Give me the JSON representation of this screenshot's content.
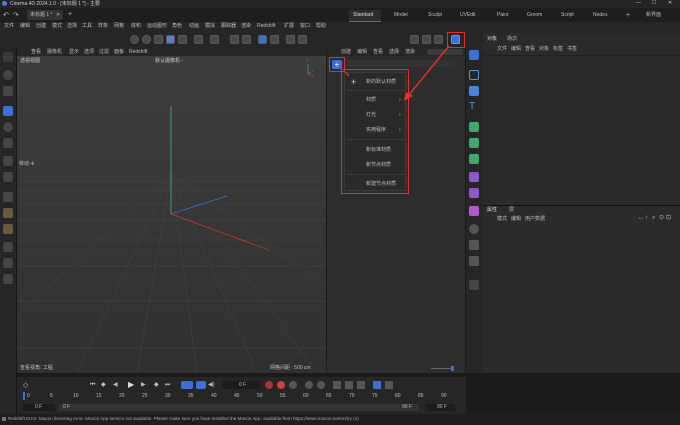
{
  "window": {
    "title": "Cinema 4D 2024.1.0 - [未标题 1 *] - 主要"
  },
  "doc_tab": {
    "label": "未标题 1 *"
  },
  "layouts": [
    "Standard",
    "Model",
    "Sculpt",
    "UVEdit",
    "Paint",
    "Groom",
    "Script",
    "Nodes"
  ],
  "new_ui": {
    "label": "新界面"
  },
  "menus": [
    "文件",
    "编辑",
    "创建",
    "模式",
    "选择",
    "工具",
    "样条",
    "网格",
    "体积",
    "运动图形",
    "角色",
    "动画",
    "模拟",
    "跟踪器",
    "渲染",
    "Redshift",
    "扩展",
    "窗口",
    "帮助"
  ],
  "viewport": {
    "menus": [
      "查看",
      "摄像机",
      "显示",
      "选项",
      "过滤",
      "面板",
      "Redshift"
    ],
    "name": "透视视图",
    "camera": "默认摄像机 ◦",
    "move_label": "移动 ✣",
    "display_mode": "查看视角: 工程",
    "grid_spacing": "网格间距 : 500 cm",
    "axis": {
      "y": "Y",
      "x": "X",
      "z": "Z"
    }
  },
  "mid_panel": {
    "menus": [
      "创建",
      "编辑",
      "查看",
      "选择",
      "渲染"
    ],
    "dropdown": [
      {
        "label": "新的默认材质",
        "icon": "plus-icon"
      },
      {
        "label": "材质",
        "submenu": true
      },
      {
        "label": "灯光",
        "submenu": true
      },
      {
        "label": "实用程序",
        "submenu": true
      },
      {
        "label": "新标准材质"
      },
      {
        "label": "新节点材质"
      },
      {
        "label": "新建节点材质"
      }
    ]
  },
  "objects_panel": {
    "tabs": [
      "对象",
      "场次"
    ],
    "menus": [
      "文件",
      "编辑",
      "查看",
      "对象",
      "标签",
      "书签"
    ]
  },
  "attributes_panel": {
    "tabs": [
      "属性",
      "层"
    ],
    "menus": [
      "模式",
      "编辑",
      "用户数据"
    ]
  },
  "timeline": {
    "current_frame": "0 F",
    "ticks": [
      "0",
      "5",
      "10",
      "15",
      "20",
      "25",
      "30",
      "35",
      "40",
      "45",
      "50",
      "55",
      "60",
      "65",
      "70",
      "75",
      "80",
      "85",
      "90"
    ],
    "start": "0 F",
    "start2": "0 F",
    "end": "90 F",
    "end2": "90 F"
  },
  "status": {
    "text": "Redshift Error: Maxon licensing error: Maxon App service not available. Please make sure you have installed the Maxon App, available from https://www.maxon.net/en/try (4)"
  },
  "colors": {
    "accent": "#3d6fd6",
    "highlight": "#e0302a",
    "y_axis": "#3fb57a",
    "x_axis": "#c0392b",
    "z_axis": "#3f6fd6"
  }
}
